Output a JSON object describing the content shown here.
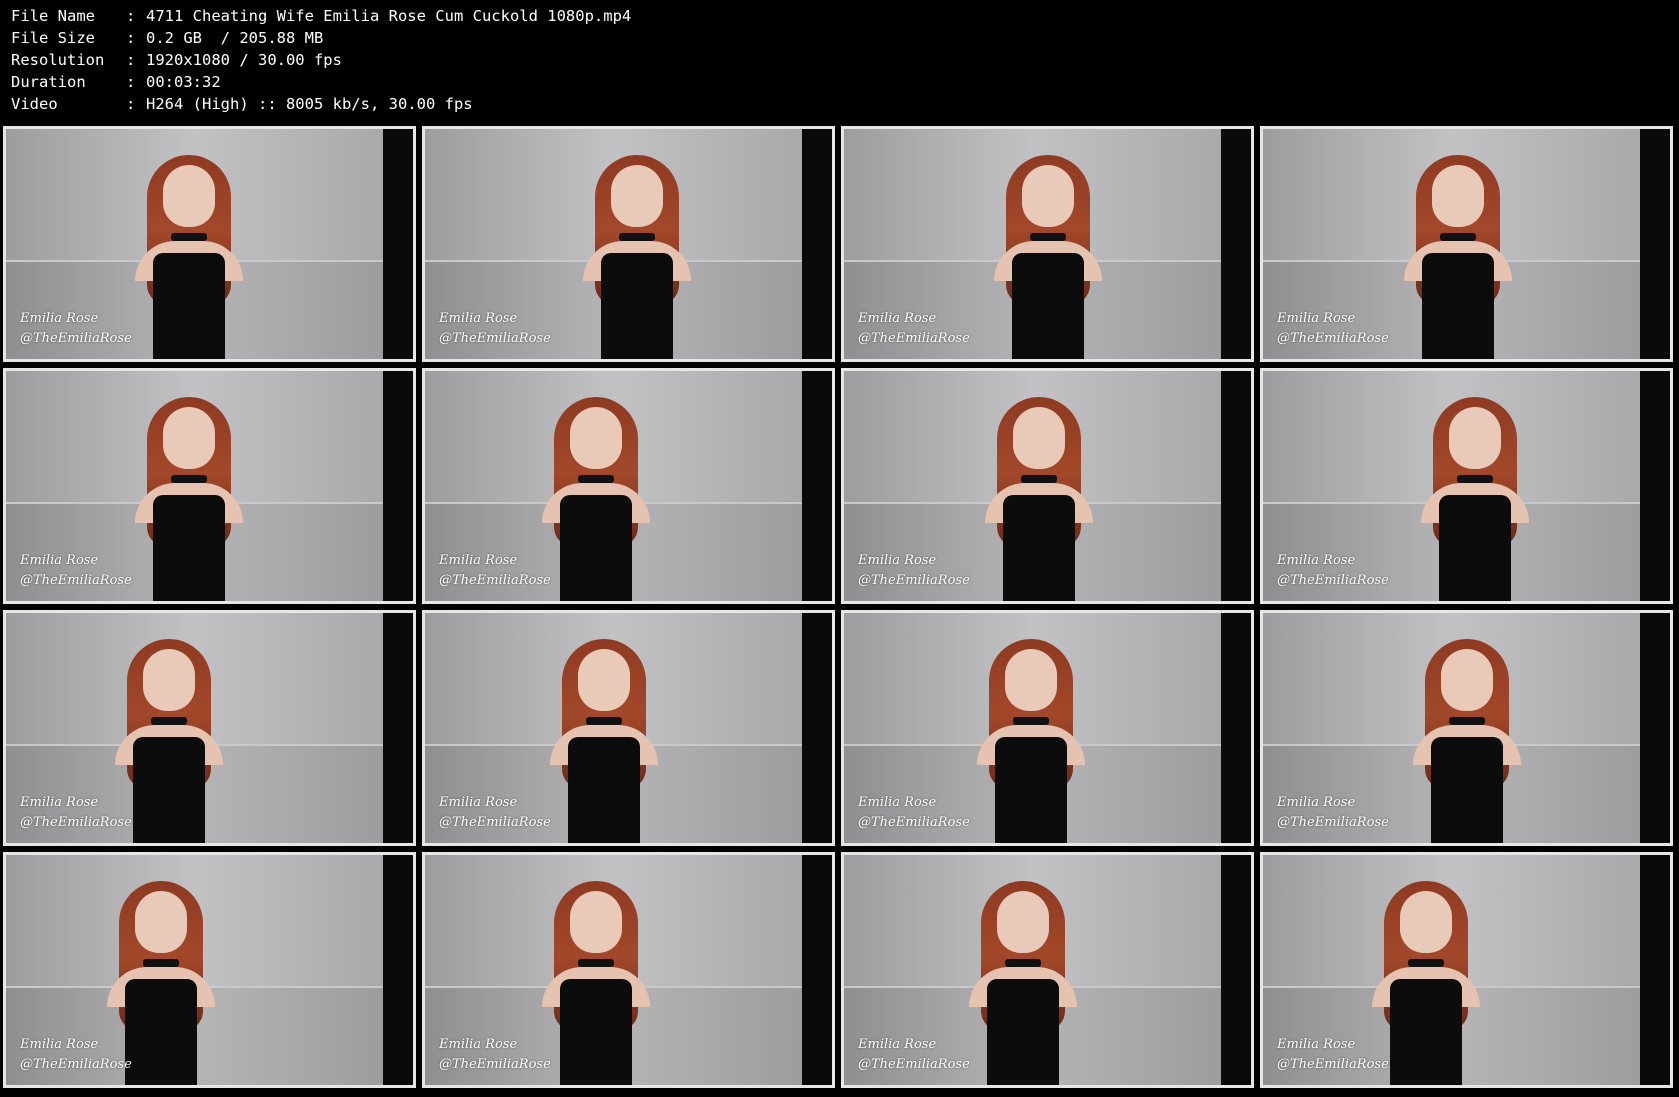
{
  "header": {
    "rows": [
      {
        "label": "File Name",
        "sep": ":",
        "value": "4711 Cheating Wife Emilia Rose Cum Cuckold 1080p.mp4"
      },
      {
        "label": "File Size",
        "sep": ":",
        "value": "0.2 GB  / 205.88 MB"
      },
      {
        "label": "Resolution",
        "sep": ":",
        "value": "1920x1080 / 30.00 fps"
      },
      {
        "label": "Duration",
        "sep": ":",
        "value": "00:03:32"
      },
      {
        "label": "Video",
        "sep": ":",
        "value": "H264 (High) :: 8005 kb/s, 30.00 fps"
      }
    ]
  },
  "watermark": {
    "line1": "Emilia Rose",
    "line2": "@TheEmiliaRose"
  },
  "thumbnails": [
    {
      "fig": 0.45
    },
    {
      "fig": 0.52
    },
    {
      "fig": 0.5
    },
    {
      "fig": 0.48
    },
    {
      "fig": 0.45
    },
    {
      "fig": 0.42
    },
    {
      "fig": 0.48
    },
    {
      "fig": 0.52
    },
    {
      "fig": 0.4
    },
    {
      "fig": 0.44
    },
    {
      "fig": 0.46
    },
    {
      "fig": 0.5
    },
    {
      "fig": 0.38
    },
    {
      "fig": 0.42
    },
    {
      "fig": 0.44
    },
    {
      "fig": 0.4
    }
  ],
  "colors": {
    "background": "#000000",
    "thumb_border": "#e6e6e6",
    "text": "#ffffff",
    "hair": "#a3482a",
    "dress": "#0c0c0c"
  }
}
